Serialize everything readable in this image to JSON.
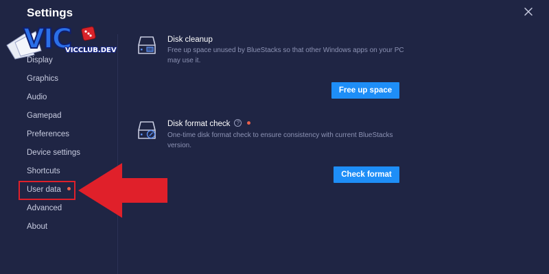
{
  "window": {
    "title": "Settings"
  },
  "sidebar": {
    "items": [
      {
        "label": "Display"
      },
      {
        "label": "Graphics"
      },
      {
        "label": "Audio"
      },
      {
        "label": "Gamepad"
      },
      {
        "label": "Preferences"
      },
      {
        "label": "Device settings"
      },
      {
        "label": "Shortcuts"
      },
      {
        "label": "User data",
        "badge": "dot",
        "highlighted": true
      },
      {
        "label": "Advanced"
      },
      {
        "label": "About"
      }
    ]
  },
  "main": {
    "disk_cleanup": {
      "title": "Disk cleanup",
      "description": "Free up space unused by BlueStacks so that other Windows apps on your PC may use it.",
      "button": "Free up space",
      "icon": "disk-cleanup-icon"
    },
    "disk_format": {
      "title": "Disk format check",
      "help": "?",
      "description": "One-time disk format check to ensure consistency with current BlueStacks version.",
      "button": "Check format",
      "icon": "disk-check-icon"
    }
  },
  "watermark": {
    "logo_text": "VIC",
    "url": "VICCLUB.DEV"
  },
  "colors": {
    "background": "#1f2544",
    "accent": "#1e8ef7",
    "notification_dot": "#e8604c",
    "annotation_red": "#e0202a"
  }
}
